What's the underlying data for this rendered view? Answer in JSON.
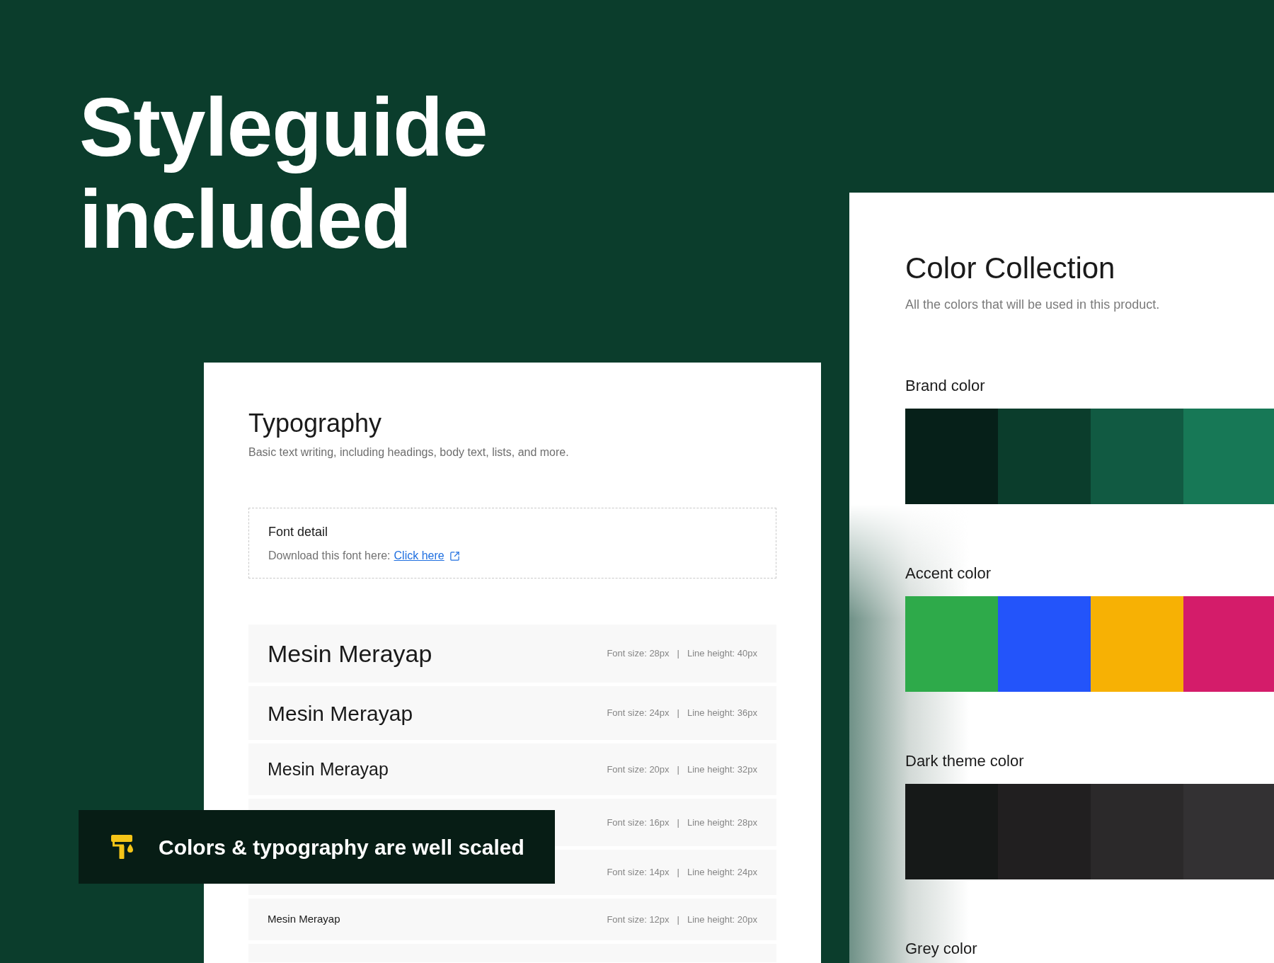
{
  "hero": {
    "title": "Styleguide included"
  },
  "typography_card": {
    "title": "Typography",
    "subtitle": "Basic text writing, including headings, body text, lists, and more.",
    "font_detail": {
      "title": "Font detail",
      "text": "Download this font here:",
      "link": "Click here"
    },
    "rows": [
      {
        "sample": "Mesin Merayap",
        "font_size": "Font size: 28px",
        "separator": "|",
        "line_height": "Line height: 40px"
      },
      {
        "sample": "Mesin Merayap",
        "font_size": "Font size: 24px",
        "separator": "|",
        "line_height": "Line height: 36px"
      },
      {
        "sample": "Mesin Merayap",
        "font_size": "Font size: 20px",
        "separator": "|",
        "line_height": "Line height: 32px"
      },
      {
        "font_size": "Font size: 16px",
        "separator": "|",
        "line_height": "Line height: 28px"
      },
      {
        "font_size": "Font size: 14px",
        "separator": "|",
        "line_height": "Line height: 24px"
      },
      {
        "sample": "Mesin Merayap",
        "font_size": "Font size: 12px",
        "separator": "|",
        "line_height": "Line height: 20px"
      }
    ]
  },
  "color_panel": {
    "title": "Color Collection",
    "subtitle": "All the colors that will be used in this product.",
    "groups": [
      {
        "label": "Brand color",
        "swatches": [
          {
            "color": "#062019"
          },
          {
            "color": "#0b3d2c"
          },
          {
            "color": "#115a42"
          },
          {
            "color": "#177856"
          }
        ]
      },
      {
        "label": "Accent color",
        "swatches": [
          {
            "color": "#2eaa4a"
          },
          {
            "color": "#2354fa"
          },
          {
            "color": "#f7b104"
          },
          {
            "color": "#d41c6a"
          }
        ]
      },
      {
        "label": "Dark theme color",
        "swatches": [
          {
            "color": "#161918"
          },
          {
            "color": "#211f20"
          },
          {
            "color": "#2b292a"
          },
          {
            "color": "#333133"
          }
        ]
      },
      {
        "label": "Grey color"
      }
    ]
  },
  "toast": {
    "text": "Colors & typography are well scaled"
  }
}
